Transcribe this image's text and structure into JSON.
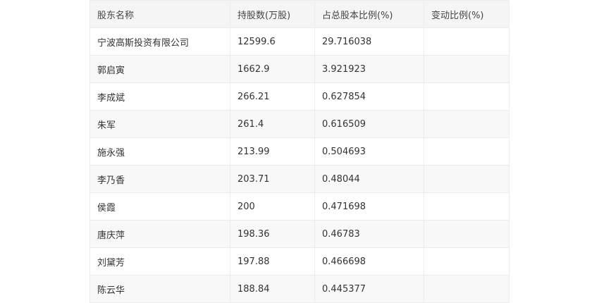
{
  "table": {
    "headers": [
      "股东名称",
      "持股数(万股)",
      "占总股本比例(%)",
      "变动比例(%)"
    ],
    "rows": [
      [
        "宁波高斯投资有限公司",
        "12599.6",
        "29.716038",
        ""
      ],
      [
        "郭启寅",
        "1662.9",
        "3.921923",
        ""
      ],
      [
        "李成斌",
        "266.21",
        "0.627854",
        ""
      ],
      [
        "朱军",
        "261.4",
        "0.616509",
        ""
      ],
      [
        "施永强",
        "213.99",
        "0.504693",
        ""
      ],
      [
        "李乃香",
        "203.71",
        "0.48044",
        ""
      ],
      [
        "侯霞",
        "200",
        "0.471698",
        ""
      ],
      [
        "唐庆萍",
        "198.36",
        "0.46783",
        ""
      ],
      [
        "刘黛芳",
        "197.88",
        "0.466698",
        ""
      ],
      [
        "陈云华",
        "188.84",
        "0.445377",
        ""
      ]
    ]
  }
}
